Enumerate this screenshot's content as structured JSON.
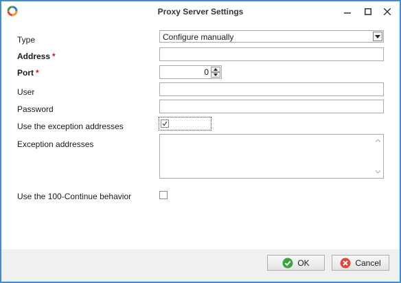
{
  "window": {
    "title": "Proxy Server Settings",
    "accent_color": "#3c8fd6"
  },
  "form": {
    "type": {
      "label": "Type",
      "value": "Configure manually"
    },
    "address": {
      "label": "Address",
      "required_mark": "*",
      "value": ""
    },
    "port": {
      "label": "Port",
      "required_mark": "*",
      "value": "0"
    },
    "user": {
      "label": "User",
      "value": ""
    },
    "password": {
      "label": "Password",
      "value": ""
    },
    "use_exception": {
      "label": "Use the exception addresses",
      "checked": true
    },
    "exception_addresses": {
      "label": "Exception addresses",
      "value": ""
    },
    "continue_behavior": {
      "label": "Use the 100-Continue behavior",
      "checked": false
    }
  },
  "buttons": {
    "ok": {
      "label": "OK",
      "icon": "check-circle-icon",
      "color": "#3ca33c"
    },
    "cancel": {
      "label": "Cancel",
      "icon": "x-circle-icon",
      "color": "#e2463a"
    }
  }
}
